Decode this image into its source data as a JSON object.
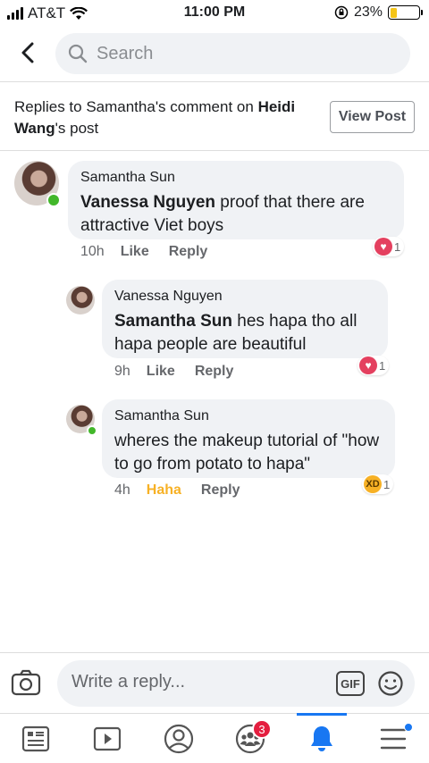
{
  "status_bar": {
    "carrier": "AT&T",
    "time": "11:00 PM",
    "battery_pct": "23%",
    "battery_level": 0.23
  },
  "search": {
    "placeholder": "Search"
  },
  "context": {
    "prefix": "Replies to Samantha's comment on ",
    "post_owner": "Heidi Wang",
    "suffix": "'s post",
    "view_post_label": "View Post"
  },
  "comments": [
    {
      "author": "Samantha Sun",
      "mention": "Vanessa Nguyen",
      "text": " proof that there are attractive Viet boys",
      "time": "10h",
      "like_label": "Like",
      "reply_label": "Reply",
      "reaction_icon": "heart-icon",
      "reaction_count": "1",
      "online": true
    },
    {
      "author": "Vanessa Nguyen",
      "mention": "Samantha Sun",
      "text": " hes hapa tho all hapa people are beautiful",
      "time": "9h",
      "like_label": "Like",
      "reply_label": "Reply",
      "reaction_icon": "heart-icon",
      "reaction_count": "1",
      "online": false
    },
    {
      "author": "Samantha Sun",
      "mention": "",
      "text": "wheres the makeup tutorial of \"how to go from potato to hapa\"",
      "time": "4h",
      "like_label": "Haha",
      "reply_label": "Reply",
      "reaction_icon": "haha-icon",
      "reaction_count": "1",
      "online": true
    }
  ],
  "composer": {
    "placeholder": "Write a reply...",
    "gif_label": "GIF"
  },
  "nav": {
    "groups_badge": "3",
    "active": "notifications"
  },
  "colors": {
    "accent": "#1877f2",
    "heart": "#e4405f",
    "haha": "#f7b125",
    "online": "#42b72a",
    "badge": "#e41e3f"
  }
}
